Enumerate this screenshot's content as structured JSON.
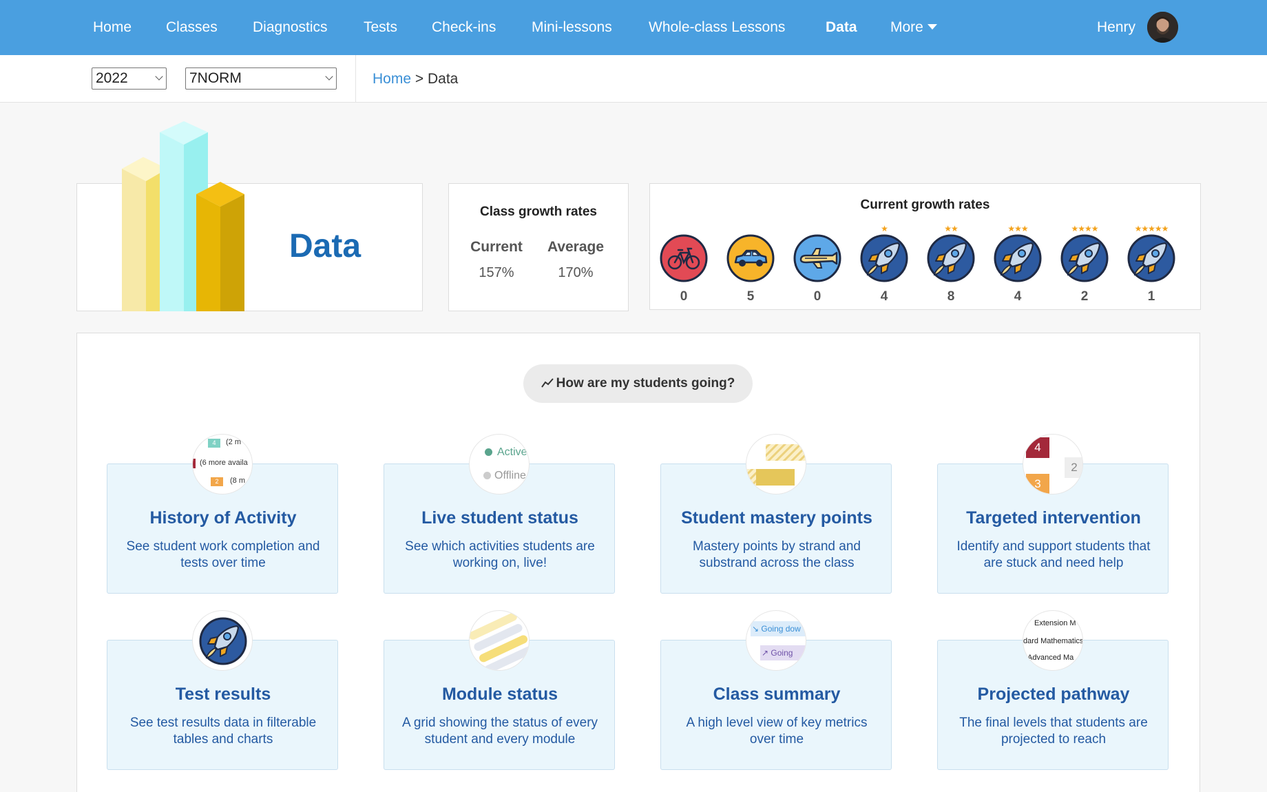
{
  "nav": {
    "items": [
      {
        "label": "Home"
      },
      {
        "label": "Classes"
      },
      {
        "label": "Diagnostics"
      },
      {
        "label": "Tests"
      },
      {
        "label": "Check-ins"
      },
      {
        "label": "Mini-lessons"
      },
      {
        "label": "Whole-class Lessons"
      },
      {
        "label": "Data"
      }
    ],
    "more_label": "More",
    "user_name": "Henry"
  },
  "subbar": {
    "year": "2022",
    "class": "7NORM",
    "breadcrumb_home": "Home",
    "breadcrumb_sep": ">",
    "breadcrumb_current": "Data"
  },
  "header": {
    "title": "Data"
  },
  "class_growth": {
    "title": "Class growth rates",
    "current_label": "Current",
    "current_value": "157%",
    "average_label": "Average",
    "average_value": "170%"
  },
  "current_growth": {
    "title": "Current growth rates",
    "items": [
      {
        "icon": "bicycle-icon",
        "stars": "",
        "count": "0"
      },
      {
        "icon": "car-icon",
        "stars": "",
        "count": "5"
      },
      {
        "icon": "plane-icon",
        "stars": "",
        "count": "0"
      },
      {
        "icon": "rocket-icon",
        "stars": "★",
        "count": "4"
      },
      {
        "icon": "rocket-icon",
        "stars": "★★",
        "count": "8"
      },
      {
        "icon": "rocket-icon",
        "stars": "★★★",
        "count": "4"
      },
      {
        "icon": "rocket-icon",
        "stars": "★★★★",
        "count": "2"
      },
      {
        "icon": "rocket-icon",
        "stars": "★★★★★",
        "count": "1"
      }
    ]
  },
  "main": {
    "pill_label": "How are my students going?",
    "tiles": [
      {
        "title": "History of Activity",
        "desc": "See student work completion and tests over time"
      },
      {
        "title": "Live student status",
        "desc": "See which activities students are working on, live!"
      },
      {
        "title": "Student mastery points",
        "desc": "Mastery points by strand and substrand across the class"
      },
      {
        "title": "Targeted intervention",
        "desc": "Identify and support students that are stuck and need help"
      },
      {
        "title": "Test results",
        "desc": "See test results data in filterable tables and charts"
      },
      {
        "title": "Module status",
        "desc": "A grid showing the status of every student and every module"
      },
      {
        "title": "Class summary",
        "desc": "A high level view of key metrics over time"
      },
      {
        "title": "Projected pathway",
        "desc": "The final levels that students are projected to reach"
      }
    ],
    "previews": {
      "history": {
        "b1": "4",
        "t1": "(2 m",
        "t2": "(6 more availa",
        "b3": "2",
        "t3": "(8 m"
      },
      "live": {
        "active": "Active",
        "offline": "Offline"
      },
      "intervention": {
        "n1": "4",
        "n2": "2",
        "n3": "3"
      },
      "summary": {
        "down": "Going dow",
        "up": "Going "
      },
      "pathway": {
        "l1": "Extension M",
        "l2": "dard Mathematics",
        "l3": "Advanced Ma"
      }
    }
  },
  "colors": {
    "nav_bg": "#4a9fe0",
    "title_blue": "#1b6ab3",
    "tile_bg": "#eaf6fc",
    "tile_text": "#245aa2"
  }
}
